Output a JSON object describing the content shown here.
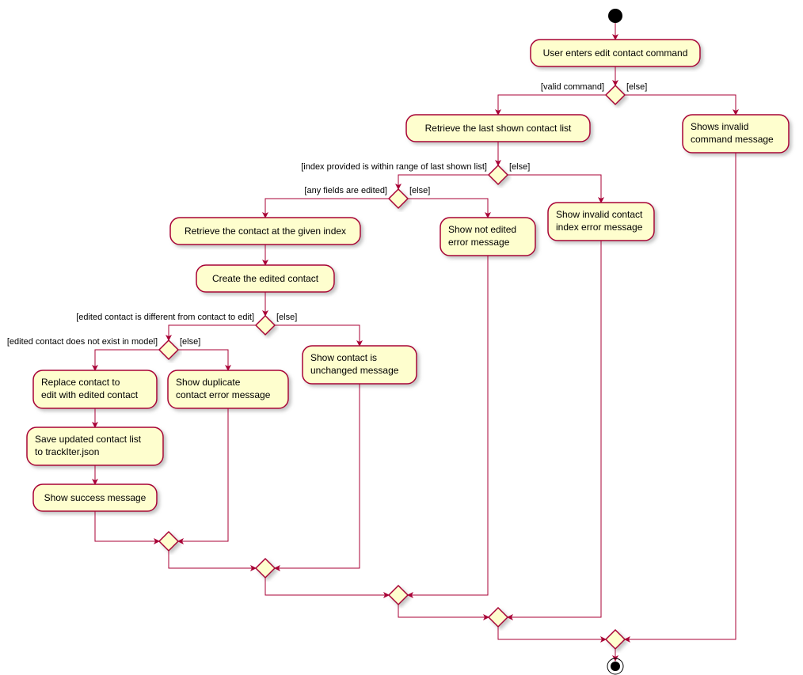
{
  "chart_data": {
    "type": "activity-diagram",
    "nodes": [
      {
        "id": "start",
        "type": "initial"
      },
      {
        "id": "a1",
        "type": "activity",
        "label": "User enters edit contact command"
      },
      {
        "id": "d1",
        "type": "decision",
        "guards": [
          "[valid command]",
          "[else]"
        ]
      },
      {
        "id": "a2",
        "type": "activity",
        "label": "Retrieve the last shown contact list"
      },
      {
        "id": "a3",
        "type": "activity",
        "label": "Shows invalid\ncommand message"
      },
      {
        "id": "d2",
        "type": "decision",
        "guards": [
          "[index provided is within range of last shown list]",
          "[else]"
        ]
      },
      {
        "id": "d3",
        "type": "decision",
        "guards": [
          "[any fields are edited]",
          "[else]"
        ]
      },
      {
        "id": "a4",
        "type": "activity",
        "label": "Show invalid contact\nindex error message"
      },
      {
        "id": "a5",
        "type": "activity",
        "label": "Retrieve the contact at the given index"
      },
      {
        "id": "a6",
        "type": "activity",
        "label": "Show not edited\nerror message"
      },
      {
        "id": "a7",
        "type": "activity",
        "label": "Create the edited contact"
      },
      {
        "id": "d4",
        "type": "decision",
        "guards": [
          "[edited contact is different from contact to edit]",
          "[else]"
        ]
      },
      {
        "id": "d5",
        "type": "decision",
        "guards": [
          "[edited contact does not exist in model]",
          "[else]"
        ]
      },
      {
        "id": "a8",
        "type": "activity",
        "label": "Show contact is\nunchanged message"
      },
      {
        "id": "a9",
        "type": "activity",
        "label": "Replace contact to\nedit with edited contact"
      },
      {
        "id": "a10",
        "type": "activity",
        "label": "Show duplicate\ncontact error message"
      },
      {
        "id": "a11",
        "type": "activity",
        "label": "Save updated contact list\nto trackIter.json"
      },
      {
        "id": "a12",
        "type": "activity",
        "label": "Show success message"
      },
      {
        "id": "m1",
        "type": "merge"
      },
      {
        "id": "m2",
        "type": "merge"
      },
      {
        "id": "m3",
        "type": "merge"
      },
      {
        "id": "m4",
        "type": "merge"
      },
      {
        "id": "m5",
        "type": "merge"
      },
      {
        "id": "end",
        "type": "final"
      }
    ]
  },
  "labels": {
    "a1": "User enters edit contact command",
    "a2": "Retrieve the last shown contact list",
    "a3_l1": "Shows invalid",
    "a3_l2": "command message",
    "a4_l1": "Show invalid contact",
    "a4_l2": "index error message",
    "a5": "Retrieve the contact at the given index",
    "a6_l1": "Show not edited",
    "a6_l2": "error message",
    "a7": "Create the edited contact",
    "a8_l1": "Show contact is",
    "a8_l2": "unchanged message",
    "a9_l1": "Replace contact to",
    "a9_l2": "edit with edited contact",
    "a10_l1": "Show duplicate",
    "a10_l2": "contact error message",
    "a11_l1": "Save updated contact list",
    "a11_l2": "to trackIter.json",
    "a12": "Show success message",
    "g_valid": "[valid command]",
    "g_else": "[else]",
    "g_index": "[index provided is within range of last shown list]",
    "g_fields": "[any fields are edited]",
    "g_diff": "[edited contact is different from contact to edit]",
    "g_notexist": "[edited contact does not exist in model]"
  }
}
